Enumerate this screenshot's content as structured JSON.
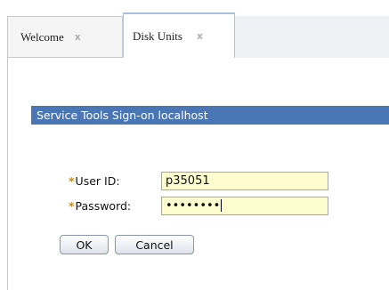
{
  "tabs": [
    {
      "label": "Welcome",
      "close": "x"
    },
    {
      "label": "Disk Units",
      "close": "x"
    }
  ],
  "dialog": {
    "title": "Service Tools Sign-on localhost",
    "required_marker": "*",
    "user_id_label": "User ID:",
    "user_id_value": "p35051",
    "password_label": "Password:",
    "password_value": "••••••••",
    "ok_label": "OK",
    "cancel_label": "Cancel"
  },
  "colors": {
    "title_bar": "#4a76b6",
    "input_bg": "#fdfdd0",
    "required_marker": "#c08a20"
  }
}
